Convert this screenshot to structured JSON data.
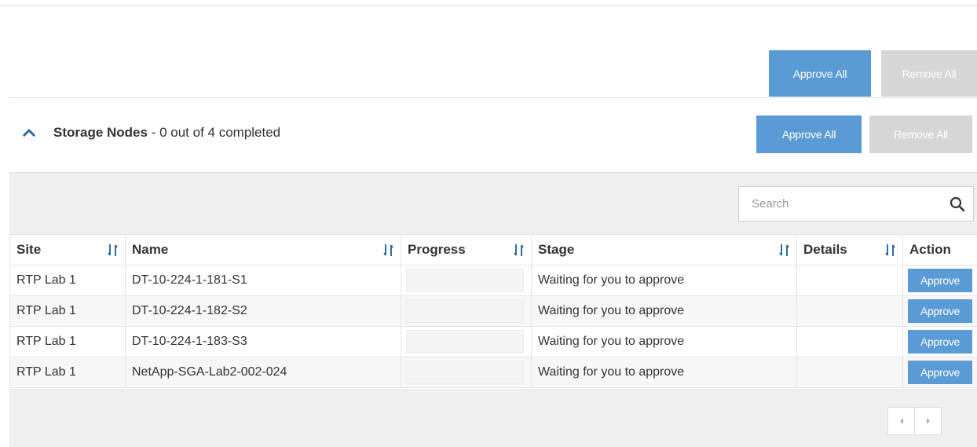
{
  "top_actions": {
    "approve_all_label": "Approve All",
    "remove_all_label": "Remove All"
  },
  "group": {
    "title": "Storage Nodes",
    "status_text": " - 0 out of 4 completed",
    "approve_all_label": "Approve All",
    "remove_all_label": "Remove All"
  },
  "search": {
    "placeholder": "Search",
    "value": ""
  },
  "table": {
    "headers": {
      "site": "Site",
      "name": "Name",
      "progress": "Progress",
      "stage": "Stage",
      "details": "Details",
      "action": "Action"
    },
    "rows": [
      {
        "site": "RTP Lab 1",
        "name": "DT-10-224-1-181-S1",
        "progress": 0,
        "stage": "Waiting for you to approve",
        "details": "",
        "action": "Approve"
      },
      {
        "site": "RTP Lab 1",
        "name": "DT-10-224-1-182-S2",
        "progress": 0,
        "stage": "Waiting for you to approve",
        "details": "",
        "action": "Approve"
      },
      {
        "site": "RTP Lab 1",
        "name": "DT-10-224-1-183-S3",
        "progress": 0,
        "stage": "Waiting for you to approve",
        "details": "",
        "action": "Approve"
      },
      {
        "site": "RTP Lab 1",
        "name": "NetApp-SGA-Lab2-002-024",
        "progress": 0,
        "stage": "Waiting for you to approve",
        "details": "",
        "action": "Approve"
      }
    ]
  },
  "colors": {
    "primary": "#5b9bd5",
    "disabled": "#d6d6d6",
    "band": "#efefef"
  },
  "icons": {
    "collapse": "chevron-up-icon",
    "search": "search-icon",
    "sort": "sort-icon",
    "prev": "chevron-left-icon",
    "next": "chevron-right-icon"
  }
}
